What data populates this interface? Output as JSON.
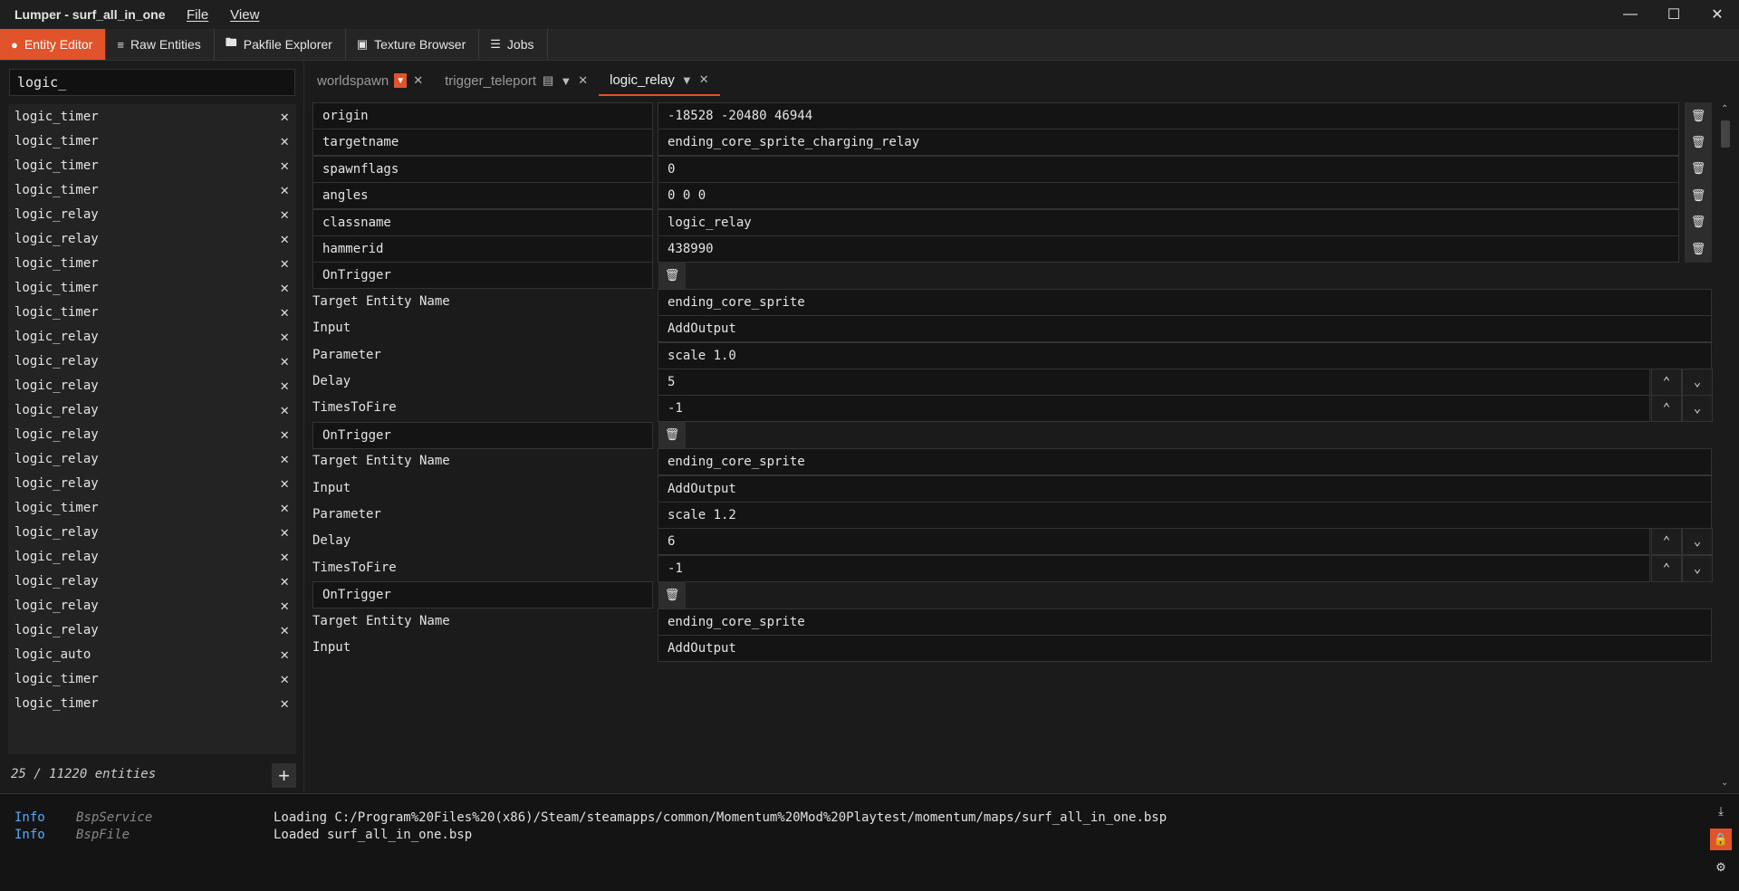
{
  "window": {
    "title": "Lumper - surf_all_in_one",
    "menus": [
      "File",
      "View"
    ]
  },
  "toolbar": {
    "tabs": [
      {
        "label": "Entity Editor",
        "icon": "lightbulb-icon",
        "active": true
      },
      {
        "label": "Raw Entities",
        "icon": "lines-icon"
      },
      {
        "label": "Pakfile Explorer",
        "icon": "folder-icon"
      },
      {
        "label": "Texture Browser",
        "icon": "image-icon"
      },
      {
        "label": "Jobs",
        "icon": "checklist-icon"
      }
    ]
  },
  "sidebar": {
    "filter_value": "logic_",
    "entities": [
      "logic_timer",
      "logic_timer",
      "logic_timer",
      "logic_timer",
      "logic_relay",
      "logic_relay",
      "logic_timer",
      "logic_timer",
      "logic_timer",
      "logic_relay",
      "logic_relay",
      "logic_relay",
      "logic_relay",
      "logic_relay",
      "logic_relay",
      "logic_relay",
      "logic_timer",
      "logic_relay",
      "logic_relay",
      "logic_relay",
      "logic_relay",
      "logic_relay",
      "logic_auto",
      "logic_timer",
      "logic_timer"
    ],
    "count_text": "25 / 11220 entities"
  },
  "tabs": [
    {
      "label": "worldspawn",
      "active": false
    },
    {
      "label": "trigger_teleport",
      "active": false
    },
    {
      "label": "logic_relay",
      "active": true
    }
  ],
  "properties": [
    {
      "key": "origin",
      "value": "-18528 -20480 46944"
    },
    {
      "key": "targetname",
      "value": "ending_core_sprite_charging_relay"
    },
    {
      "key": "spawnflags",
      "value": "0"
    },
    {
      "key": "angles",
      "value": "0 0 0"
    },
    {
      "key": "classname",
      "value": "logic_relay"
    },
    {
      "key": "hammerid",
      "value": "438990"
    }
  ],
  "outputs": [
    {
      "event": "OnTrigger",
      "target_label": "Target Entity Name",
      "target": "ending_core_sprite",
      "input_label": "Input",
      "input": "AddOutput",
      "param_label": "Parameter",
      "param": "scale 1.0",
      "delay_label": "Delay",
      "delay": "5",
      "times_label": "TimesToFire",
      "times": "-1"
    },
    {
      "event": "OnTrigger",
      "target_label": "Target Entity Name",
      "target": "ending_core_sprite",
      "input_label": "Input",
      "input": "AddOutput",
      "param_label": "Parameter",
      "param": "scale 1.2",
      "delay_label": "Delay",
      "delay": "6",
      "times_label": "TimesToFire",
      "times": "-1"
    },
    {
      "event": "OnTrigger",
      "target_label": "Target Entity Name",
      "target": "ending_core_sprite",
      "input_label": "Input",
      "input": "AddOutput"
    }
  ],
  "console": [
    {
      "level": "Info",
      "source": "BspService",
      "message": "Loading C:/Program%20Files%20(x86)/Steam/steamapps/common/Momentum%20Mod%20Playtest/momentum/maps/surf_all_in_one.bsp"
    },
    {
      "level": "Info",
      "source": "BspFile",
      "message": "Loaded surf_all_in_one.bsp"
    }
  ],
  "colors": {
    "accent": "#e0532b",
    "info": "#5aa8ff"
  }
}
